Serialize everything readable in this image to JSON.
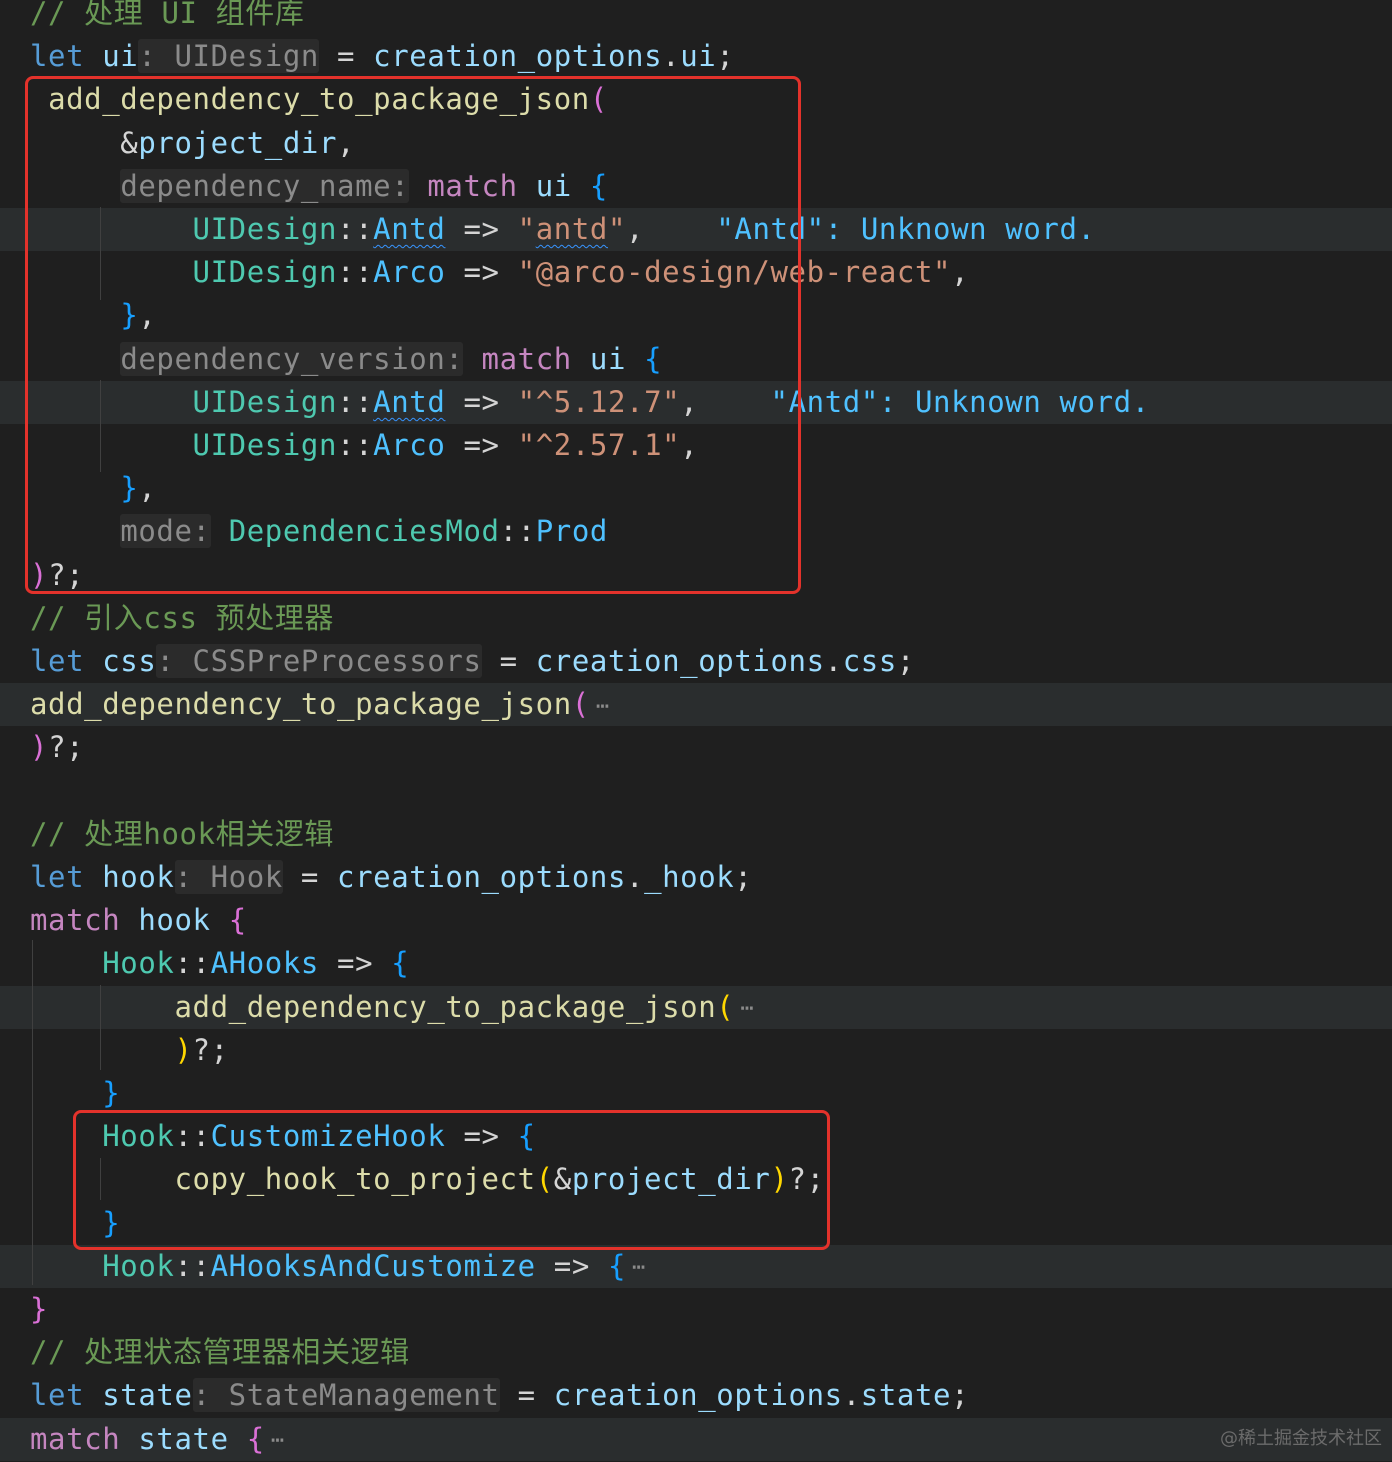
{
  "editor": {
    "colors": {
      "background": "#1f1f1f",
      "comment": "#6a9955",
      "keyword": "#569cd6",
      "control": "#c586c0",
      "variable": "#9cdcfe",
      "function": "#dcdcaa",
      "type": "#4ec9b0",
      "enum_member": "#4fc1ff",
      "string": "#ce9178",
      "highlight_box": "#e3322b"
    },
    "lines": [
      {
        "tokens": [
          [
            "c-comment",
            "// 处理 UI 组件库"
          ]
        ]
      },
      {
        "tokens": [
          [
            "c-kw",
            "let"
          ],
          [
            "c-punc",
            " "
          ],
          [
            "c-var",
            "ui"
          ],
          [
            "c-hint",
            ": UIDesign"
          ],
          [
            "c-punc",
            " = "
          ],
          [
            "c-var",
            "creation_options"
          ],
          [
            "c-punc",
            "."
          ],
          [
            "c-var",
            "ui"
          ],
          [
            "c-punc",
            ";"
          ]
        ]
      },
      {
        "tokens": [
          [
            "c-punc",
            " "
          ],
          [
            "c-fn",
            "add_dependency_to_package_json"
          ],
          [
            "c-br2",
            "("
          ]
        ]
      },
      {
        "tokens": [
          [
            "c-punc",
            "     &"
          ],
          [
            "c-var",
            "project_dir"
          ],
          [
            "c-punc",
            ","
          ]
        ]
      },
      {
        "tokens": [
          [
            "c-punc",
            "     "
          ],
          [
            "c-hint",
            "dependency_name:"
          ],
          [
            "c-punc",
            " "
          ],
          [
            "c-ctrl",
            "match"
          ],
          [
            "c-punc",
            " "
          ],
          [
            "c-var",
            "ui"
          ],
          [
            "c-punc",
            " "
          ],
          [
            "c-br3",
            "{"
          ]
        ]
      },
      {
        "tokens": [
          [
            "c-punc",
            "         "
          ],
          [
            "c-type",
            "UIDesign"
          ],
          [
            "c-punc",
            "::"
          ],
          [
            "c-enum squiggle",
            "Antd"
          ],
          [
            "c-punc",
            " => "
          ],
          [
            "c-str",
            "\""
          ],
          [
            "c-str squiggle",
            "antd"
          ],
          [
            "c-str",
            "\""
          ],
          [
            "c-punc",
            ","
          ],
          [
            "c-punc",
            "    "
          ],
          [
            "c-diag",
            "\"Antd\": Unknown word."
          ]
        ]
      },
      {
        "tokens": [
          [
            "c-punc",
            "         "
          ],
          [
            "c-type",
            "UIDesign"
          ],
          [
            "c-punc",
            "::"
          ],
          [
            "c-enum",
            "Arco"
          ],
          [
            "c-punc",
            " => "
          ],
          [
            "c-str",
            "\"@arco-design/web-react\""
          ],
          [
            "c-punc",
            ","
          ]
        ]
      },
      {
        "tokens": [
          [
            "c-punc",
            "     "
          ],
          [
            "c-br3",
            "}"
          ],
          [
            "c-punc",
            ","
          ]
        ]
      },
      {
        "tokens": [
          [
            "c-punc",
            "     "
          ],
          [
            "c-hint",
            "dependency_version:"
          ],
          [
            "c-punc",
            " "
          ],
          [
            "c-ctrl",
            "match"
          ],
          [
            "c-punc",
            " "
          ],
          [
            "c-var",
            "ui"
          ],
          [
            "c-punc",
            " "
          ],
          [
            "c-br3",
            "{"
          ]
        ]
      },
      {
        "tokens": [
          [
            "c-punc",
            "         "
          ],
          [
            "c-type",
            "UIDesign"
          ],
          [
            "c-punc",
            "::"
          ],
          [
            "c-enum squiggle",
            "Antd"
          ],
          [
            "c-punc",
            " => "
          ],
          [
            "c-str",
            "\"^5.12.7\""
          ],
          [
            "c-punc",
            ","
          ],
          [
            "c-punc",
            "    "
          ],
          [
            "c-diag",
            "\"Antd\": Unknown word."
          ]
        ]
      },
      {
        "tokens": [
          [
            "c-punc",
            "         "
          ],
          [
            "c-type",
            "UIDesign"
          ],
          [
            "c-punc",
            "::"
          ],
          [
            "c-enum",
            "Arco"
          ],
          [
            "c-punc",
            " => "
          ],
          [
            "c-str",
            "\"^2.57.1\""
          ],
          [
            "c-punc",
            ","
          ]
        ]
      },
      {
        "tokens": [
          [
            "c-punc",
            "     "
          ],
          [
            "c-br3",
            "}"
          ],
          [
            "c-punc",
            ","
          ]
        ]
      },
      {
        "tokens": [
          [
            "c-punc",
            "     "
          ],
          [
            "c-hint",
            "mode:"
          ],
          [
            "c-punc",
            " "
          ],
          [
            "c-type",
            "DependenciesMod"
          ],
          [
            "c-punc",
            "::"
          ],
          [
            "c-enum",
            "Prod"
          ]
        ]
      },
      {
        "tokens": [
          [
            "c-br2",
            ")"
          ],
          [
            "c-punc",
            "?;"
          ]
        ]
      },
      {
        "tokens": [
          [
            "c-comment",
            "// 引入css 预处理器"
          ]
        ]
      },
      {
        "tokens": [
          [
            "c-kw",
            "let"
          ],
          [
            "c-punc",
            " "
          ],
          [
            "c-var",
            "css"
          ],
          [
            "c-hint",
            ": CSSPreProcessors"
          ],
          [
            "c-punc",
            " = "
          ],
          [
            "c-var",
            "creation_options"
          ],
          [
            "c-punc",
            "."
          ],
          [
            "c-var",
            "css"
          ],
          [
            "c-punc",
            ";"
          ]
        ]
      },
      {
        "tokens": [
          [
            "c-fn",
            "add_dependency_to_package_json"
          ],
          [
            "c-br2",
            "("
          ],
          [
            "c-fold",
            "⋯"
          ]
        ]
      },
      {
        "tokens": [
          [
            "c-br2",
            ")"
          ],
          [
            "c-punc",
            "?;"
          ]
        ]
      },
      {
        "tokens": []
      },
      {
        "tokens": [
          [
            "c-comment",
            "// 处理hook相关逻辑"
          ]
        ]
      },
      {
        "tokens": [
          [
            "c-kw",
            "let"
          ],
          [
            "c-punc",
            " "
          ],
          [
            "c-var",
            "hook"
          ],
          [
            "c-hint",
            ": Hook"
          ],
          [
            "c-punc",
            " = "
          ],
          [
            "c-var",
            "creation_options"
          ],
          [
            "c-punc",
            "."
          ],
          [
            "c-var",
            "_hook"
          ],
          [
            "c-punc",
            ";"
          ]
        ]
      },
      {
        "tokens": [
          [
            "c-ctrl",
            "match"
          ],
          [
            "c-punc",
            " "
          ],
          [
            "c-var",
            "hook"
          ],
          [
            "c-punc",
            " "
          ],
          [
            "c-br2",
            "{"
          ]
        ]
      },
      {
        "tokens": [
          [
            "c-punc",
            "    "
          ],
          [
            "c-type",
            "Hook"
          ],
          [
            "c-punc",
            "::"
          ],
          [
            "c-enum",
            "AHooks"
          ],
          [
            "c-punc",
            " => "
          ],
          [
            "c-br3",
            "{"
          ]
        ]
      },
      {
        "tokens": [
          [
            "c-punc",
            "        "
          ],
          [
            "c-fn",
            "add_dependency_to_package_json"
          ],
          [
            "c-br1",
            "("
          ],
          [
            "c-fold",
            "⋯"
          ]
        ]
      },
      {
        "tokens": [
          [
            "c-punc",
            "        "
          ],
          [
            "c-br1",
            ")"
          ],
          [
            "c-punc",
            "?;"
          ]
        ]
      },
      {
        "tokens": [
          [
            "c-punc",
            "    "
          ],
          [
            "c-br3",
            "}"
          ]
        ]
      },
      {
        "tokens": [
          [
            "c-punc",
            "    "
          ],
          [
            "c-type",
            "Hook"
          ],
          [
            "c-punc",
            "::"
          ],
          [
            "c-enum",
            "CustomizeHook"
          ],
          [
            "c-punc",
            " => "
          ],
          [
            "c-br3",
            "{"
          ]
        ]
      },
      {
        "tokens": [
          [
            "c-punc",
            "        "
          ],
          [
            "c-fn",
            "copy_hook_to_project"
          ],
          [
            "c-br1",
            "("
          ],
          [
            "c-punc",
            "&"
          ],
          [
            "c-var",
            "project_dir"
          ],
          [
            "c-br1",
            ")"
          ],
          [
            "c-punc",
            "?;"
          ]
        ]
      },
      {
        "tokens": [
          [
            "c-punc",
            "    "
          ],
          [
            "c-br3",
            "}"
          ]
        ]
      },
      {
        "tokens": [
          [
            "c-punc",
            "    "
          ],
          [
            "c-type",
            "Hook"
          ],
          [
            "c-punc",
            "::"
          ],
          [
            "c-enum",
            "AHooksAndCustomize"
          ],
          [
            "c-punc",
            " => "
          ],
          [
            "c-br3",
            "{"
          ],
          [
            "c-fold",
            "⋯"
          ]
        ]
      },
      {
        "tokens": [
          [
            "c-br2",
            "}"
          ]
        ]
      },
      {
        "tokens": [
          [
            "c-comment",
            "// 处理状态管理器相关逻辑"
          ]
        ]
      },
      {
        "tokens": [
          [
            "c-kw",
            "let"
          ],
          [
            "c-punc",
            " "
          ],
          [
            "c-var",
            "state"
          ],
          [
            "c-hint",
            ": StateManagement"
          ],
          [
            "c-punc",
            " = "
          ],
          [
            "c-var",
            "creation_options"
          ],
          [
            "c-punc",
            "."
          ],
          [
            "c-var",
            "state"
          ],
          [
            "c-punc",
            ";"
          ]
        ]
      },
      {
        "tokens": [
          [
            "c-ctrl",
            "match"
          ],
          [
            "c-punc",
            " "
          ],
          [
            "c-var",
            "state"
          ],
          [
            "c-punc",
            " "
          ],
          [
            "c-br2",
            "{"
          ],
          [
            "c-fold",
            "⋯"
          ]
        ]
      }
    ]
  },
  "watermark": "@稀土掘金技术社区"
}
